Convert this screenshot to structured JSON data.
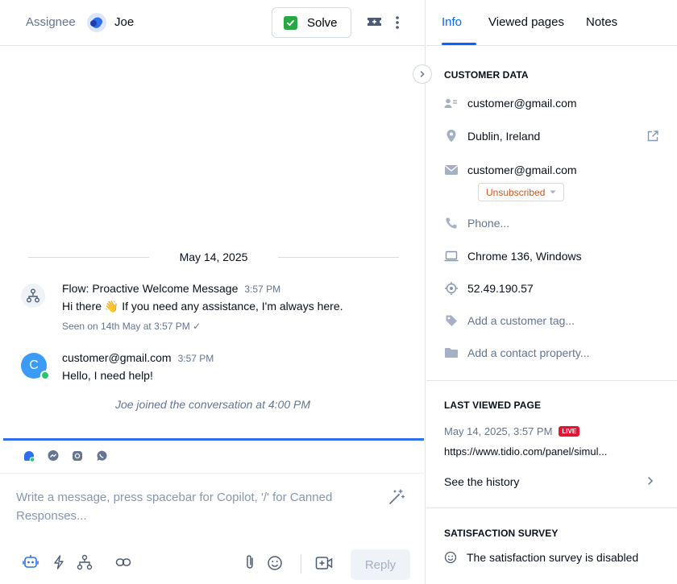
{
  "header": {
    "assignee_label": "Assignee",
    "assignee_name": "Joe",
    "solve_label": "Solve"
  },
  "conversation": {
    "date": "May 14, 2025",
    "messages": [
      {
        "author": "Flow: Proactive Welcome Message",
        "time": "3:57 PM",
        "text": "Hi there 👋 If you need any assistance, I'm always here.",
        "seen": "Seen on 14th May at 3:57 PM ✓"
      },
      {
        "author": "customer@gmail.com",
        "avatar_letter": "C",
        "time": "3:57 PM",
        "text": "Hello, I need help!"
      }
    ],
    "event": "Joe joined the conversation at 4:00 PM"
  },
  "composer": {
    "placeholder": "Write a message, press spacebar for Copilot, '/' for Canned Responses...",
    "reply_label": "Reply",
    "channels": [
      "widget-icon",
      "messenger-icon",
      "instagram-icon",
      "whatsapp-icon"
    ]
  },
  "tabs": [
    "Info",
    "Viewed pages",
    "Notes"
  ],
  "customer_data": {
    "title": "CUSTOMER DATA",
    "name": "customer@gmail.com",
    "location": "Dublin, Ireland",
    "email": "customer@gmail.com",
    "subscription_status": "Unsubscribed",
    "phone_placeholder": "Phone...",
    "browser": "Chrome 136, Windows",
    "ip": "52.49.190.57",
    "add_tag": "Add a customer tag...",
    "add_property": "Add a contact property..."
  },
  "last_viewed": {
    "title": "LAST VIEWED PAGE",
    "date": "May 14, 2025, 3:57 PM",
    "badge": "LIVE",
    "url": "https://www.tidio.com/panel/simul...",
    "history_label": "See the history"
  },
  "satisfaction": {
    "title": "SATISFACTION SURVEY",
    "status": "The satisfaction survey is disabled"
  },
  "colors": {
    "accent": "#0566ff",
    "composer_focus": "#2f6fed",
    "success": "#28a745",
    "live": "#e81332",
    "unsubscribed": "#d2561a",
    "avatar": "#3b9bf5"
  }
}
